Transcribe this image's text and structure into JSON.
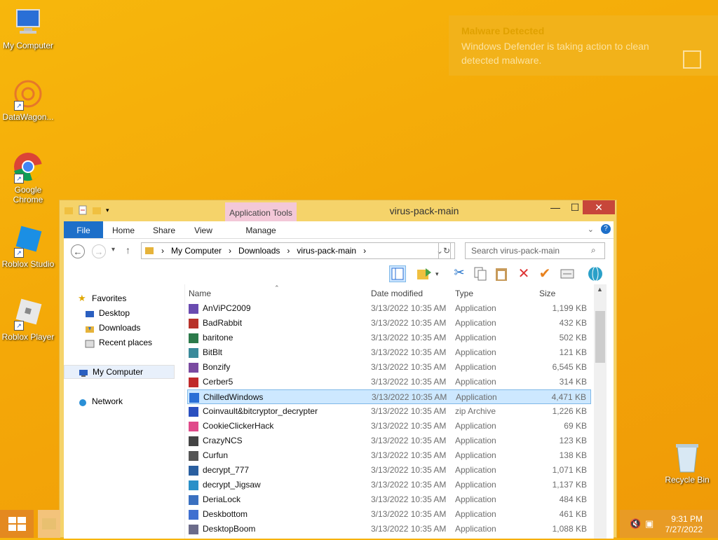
{
  "desktop": {
    "icons": [
      {
        "label": "My Computer"
      },
      {
        "label": "DataWagon..."
      },
      {
        "label": "Google Chrome"
      },
      {
        "label": "Roblox Studio"
      },
      {
        "label": "Roblox Player"
      }
    ],
    "recycle_bin": "Recycle Bin"
  },
  "toast": {
    "title": "Malware Detected",
    "message": "Windows Defender is taking action to clean detected malware."
  },
  "window": {
    "title": "virus-pack-main",
    "context_tab_group": "Application Tools",
    "controls": {
      "minimize": "—",
      "maximize": "☐",
      "close": "✕"
    },
    "tabs": [
      "File",
      "Home",
      "Share",
      "View",
      "Manage"
    ],
    "address": {
      "segments": [
        "My Computer",
        "Downloads",
        "virus-pack-main"
      ]
    },
    "search_placeholder": "Search virus-pack-main",
    "nav": {
      "favorites_label": "Favorites",
      "favorites": [
        "Desktop",
        "Downloads",
        "Recent places"
      ],
      "my_computer": "My Computer",
      "network": "Network"
    },
    "columns": {
      "name": "Name",
      "date": "Date modified",
      "type": "Type",
      "size": "Size"
    },
    "files": [
      {
        "name": "AnViPC2009",
        "date": "3/13/2022 10:35 AM",
        "type": "Application",
        "size": "1,199 KB"
      },
      {
        "name": "BadRabbit",
        "date": "3/13/2022 10:35 AM",
        "type": "Application",
        "size": "432 KB"
      },
      {
        "name": "baritone",
        "date": "3/13/2022 10:35 AM",
        "type": "Application",
        "size": "502 KB"
      },
      {
        "name": "BitBlt",
        "date": "3/13/2022 10:35 AM",
        "type": "Application",
        "size": "121 KB"
      },
      {
        "name": "Bonzify",
        "date": "3/13/2022 10:35 AM",
        "type": "Application",
        "size": "6,545 KB"
      },
      {
        "name": "Cerber5",
        "date": "3/13/2022 10:35 AM",
        "type": "Application",
        "size": "314 KB"
      },
      {
        "name": "ChilledWindows",
        "date": "3/13/2022 10:35 AM",
        "type": "Application",
        "size": "4,471 KB",
        "selected": true
      },
      {
        "name": "Coinvault&bitcryptor_decrypter",
        "date": "3/13/2022 10:35 AM",
        "type": "zip Archive",
        "size": "1,226 KB"
      },
      {
        "name": "CookieClickerHack",
        "date": "3/13/2022 10:35 AM",
        "type": "Application",
        "size": "69 KB"
      },
      {
        "name": "CrazyNCS",
        "date": "3/13/2022 10:35 AM",
        "type": "Application",
        "size": "123 KB"
      },
      {
        "name": "Curfun",
        "date": "3/13/2022 10:35 AM",
        "type": "Application",
        "size": "138 KB"
      },
      {
        "name": "decrypt_777",
        "date": "3/13/2022 10:35 AM",
        "type": "Application",
        "size": "1,071 KB"
      },
      {
        "name": "decrypt_Jigsaw",
        "date": "3/13/2022 10:35 AM",
        "type": "Application",
        "size": "1,137 KB"
      },
      {
        "name": "DeriaLock",
        "date": "3/13/2022 10:35 AM",
        "type": "Application",
        "size": "484 KB"
      },
      {
        "name": "Deskbottom",
        "date": "3/13/2022 10:35 AM",
        "type": "Application",
        "size": "461 KB"
      },
      {
        "name": "DesktopBoom",
        "date": "3/13/2022 10:35 AM",
        "type": "Application",
        "size": "1,088 KB"
      }
    ]
  },
  "taskbar": {
    "time": "9:31 PM",
    "date": "7/27/2022"
  },
  "colors": {
    "accent": "#1d6fc9",
    "close": "#c7463a",
    "desktop": "#f4a808"
  }
}
